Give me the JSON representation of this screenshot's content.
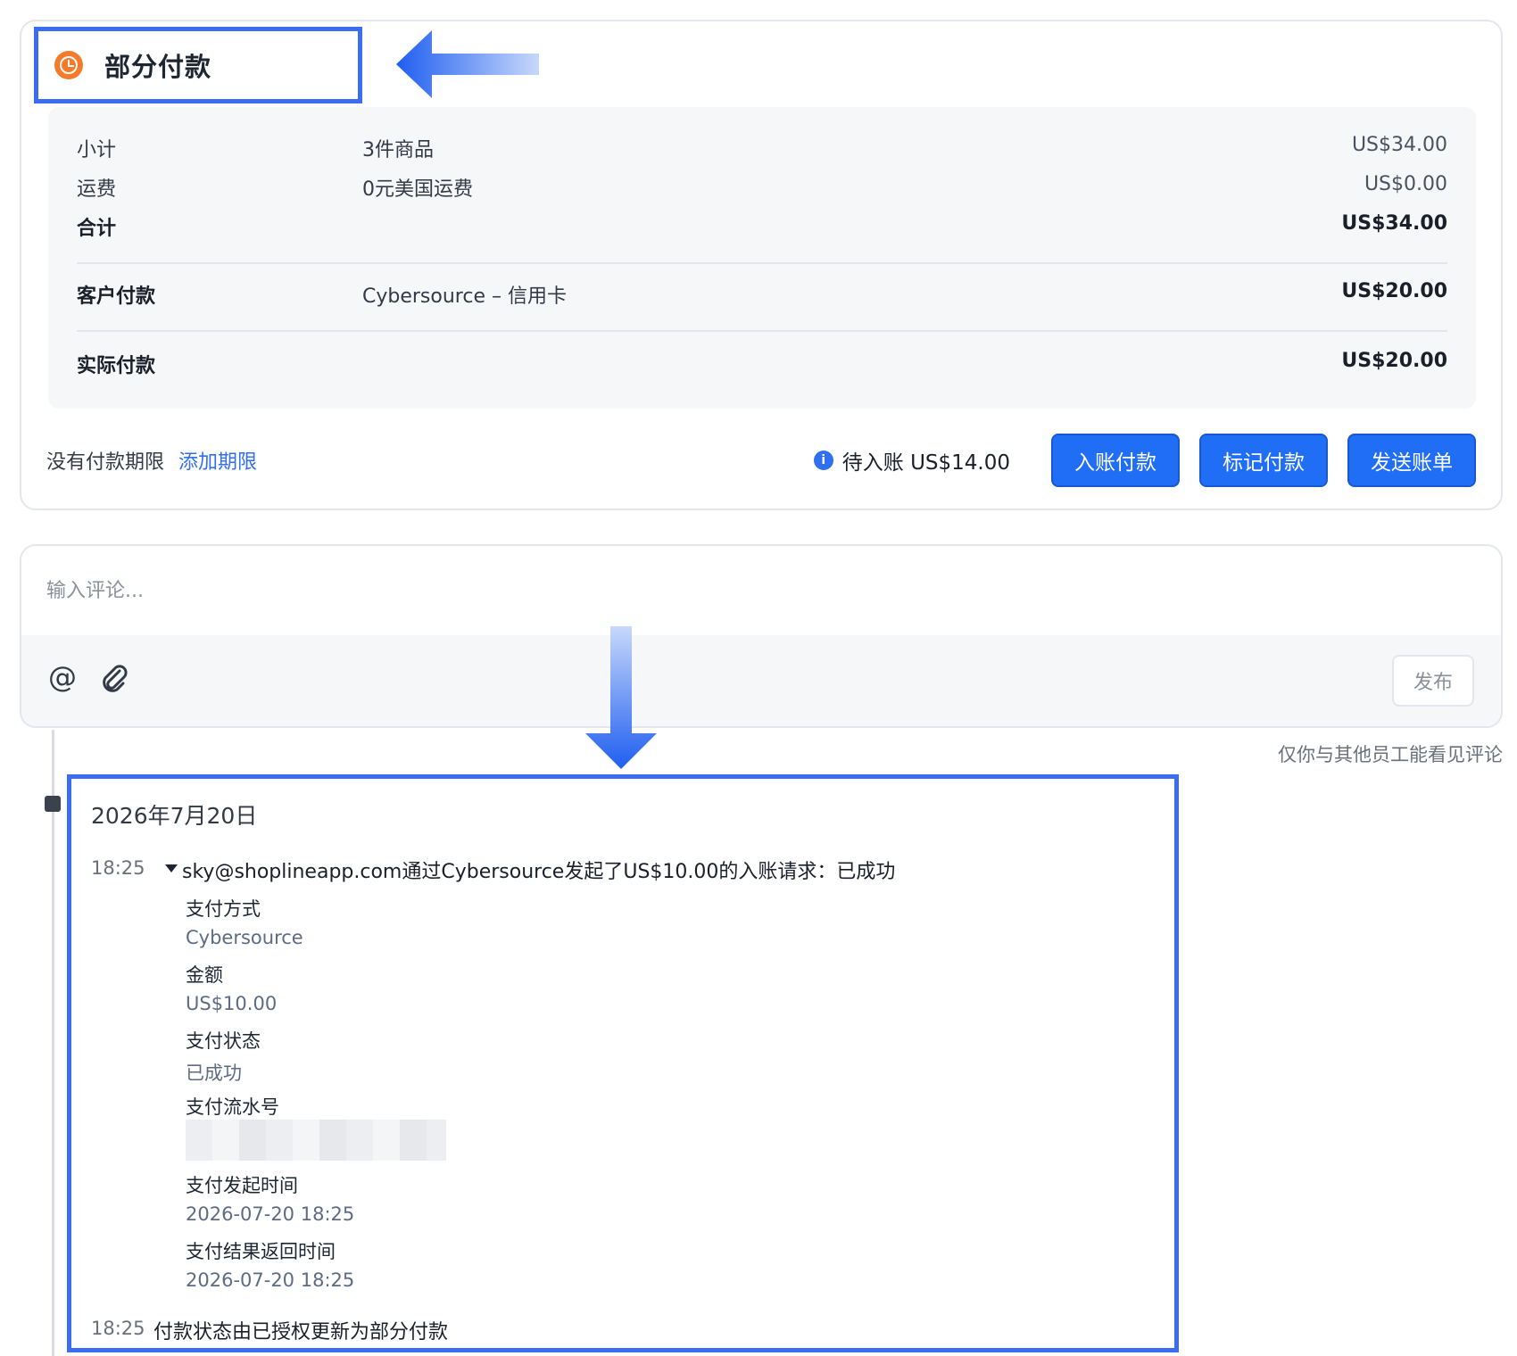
{
  "payment": {
    "status": "部分付款",
    "rows": [
      {
        "label": "小计",
        "desc": "3件商品",
        "amount": "US$34.00"
      },
      {
        "label": "运费",
        "desc": "0元美国运费",
        "amount": "US$0.00"
      },
      {
        "label": "合计",
        "desc": "",
        "amount": "US$34.00"
      },
      {
        "label": "客户付款",
        "desc": "Cybersource – 信用卡",
        "amount": "US$20.00"
      },
      {
        "label": "实际付款",
        "desc": "",
        "amount": "US$20.00"
      }
    ],
    "no_due": "没有付款期限",
    "add_due": "添加期限",
    "pending": "待入账 US$14.00",
    "buttons": {
      "capture": "入账付款",
      "mark": "标记付款",
      "send": "发送账单"
    }
  },
  "comment": {
    "placeholder": "输入评论...",
    "publish": "发布",
    "visibility": "仅你与其他员工能看见评论"
  },
  "timeline": {
    "date": "2026年7月20日",
    "events": [
      {
        "time": "18:25",
        "text": "sky@shoplineapp.com通过Cybersource发起了US$10.00的入账请求：已成功",
        "details": [
          {
            "label": "支付方式",
            "value": "Cybersource"
          },
          {
            "label": "金额",
            "value": "US$10.00"
          },
          {
            "label": "支付状态",
            "value": "已成功"
          },
          {
            "label": "支付流水号",
            "value": ""
          },
          {
            "label": "支付发起时间",
            "value": "2026-07-20 18:25"
          },
          {
            "label": "支付结果返回时间",
            "value": "2026-07-20 18:25"
          }
        ]
      },
      {
        "time": "18:25",
        "text": "付款状态由已授权更新为部分付款"
      }
    ]
  },
  "icons": {
    "status": "clock-icon",
    "info": "info-icon",
    "mention": "at-icon",
    "attach": "paperclip-icon"
  },
  "colors": {
    "accent": "#1f6ef5",
    "highlight": "#3a6df0",
    "status": "#f57a2a"
  }
}
